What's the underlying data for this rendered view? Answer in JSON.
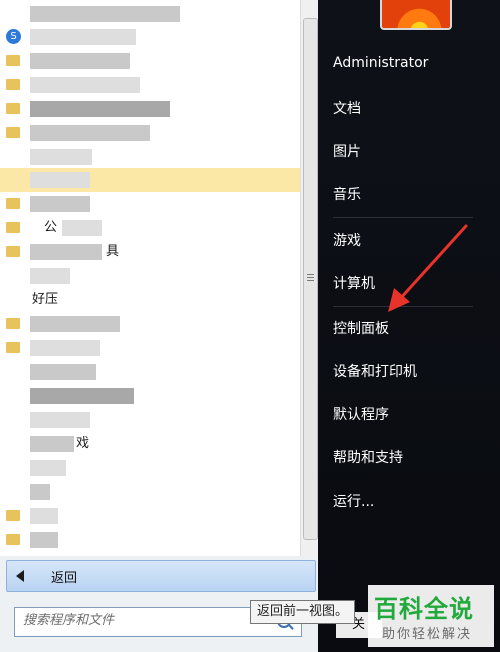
{
  "programs": {
    "visible_labels": [
      "好压",
      "戏",
      "具",
      "S",
      "公"
    ],
    "back_label": "返回",
    "search_placeholder": "搜索程序和文件"
  },
  "tooltip": {
    "text": "返回前一视图。"
  },
  "user": {
    "name": "Administrator"
  },
  "right_menu": {
    "documents": "文档",
    "pictures": "图片",
    "music": "音乐",
    "games": "游戏",
    "computer": "计算机",
    "control_panel": "控制面板",
    "devices_printers": "设备和打印机",
    "default_programs": "默认程序",
    "help_support": "帮助和支持",
    "run": "运行..."
  },
  "watermark": {
    "title": "百科全说",
    "subtitle": "助你轻松解决"
  },
  "colors": {
    "highlight": "#fbe8a6",
    "accent_arrow": "#e8332a",
    "watermark_green": "#22a93b"
  },
  "icons": {
    "back": "back-arrow-icon",
    "search": "search-icon",
    "folder": "folder-icon"
  }
}
